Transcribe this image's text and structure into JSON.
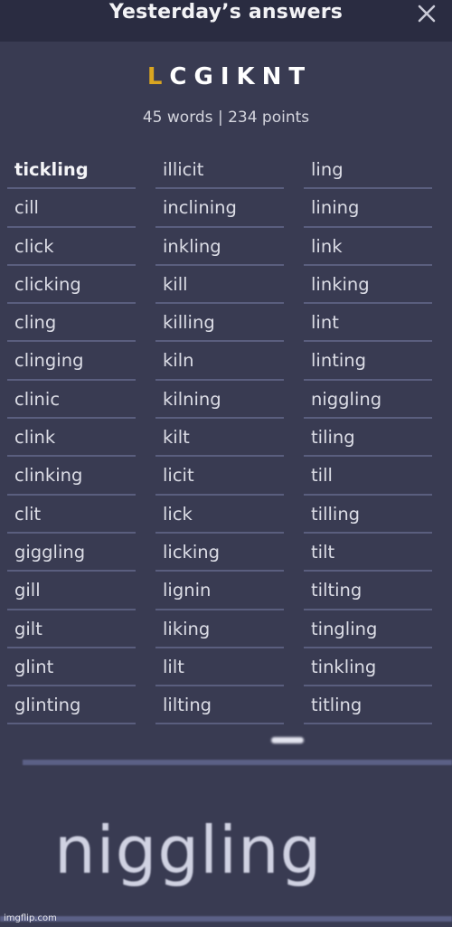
{
  "modal": {
    "title": "Yesterday’s answers",
    "close_icon": "close-x-icon"
  },
  "puzzle": {
    "center_letter": "L",
    "outer_letters": "CGIKNT",
    "center_color": "#d9a520",
    "stats": "45 words | 234 points"
  },
  "words": {
    "columns": [
      [
        "tickling",
        "cill",
        "click",
        "clicking",
        "cling",
        "clinging",
        "clinic",
        "clink",
        "clinking",
        "clit",
        "giggling",
        "gill",
        "gilt",
        "glint",
        "glinting"
      ],
      [
        "illicit",
        "inclining",
        "inkling",
        "kill",
        "killing",
        "kiln",
        "kilning",
        "kilt",
        "licit",
        "lick",
        "licking",
        "lignin",
        "liking",
        "lilt",
        "lilting"
      ],
      [
        "ling",
        "lining",
        "link",
        "linking",
        "lint",
        "linting",
        "niggling",
        "tiling",
        "till",
        "tilling",
        "tilt",
        "tilting",
        "tingling",
        "tinkling",
        "titling"
      ]
    ],
    "pangram": "tickling"
  },
  "overlay": {
    "big_word": "niggling",
    "watermark": "imgflip.com"
  }
}
